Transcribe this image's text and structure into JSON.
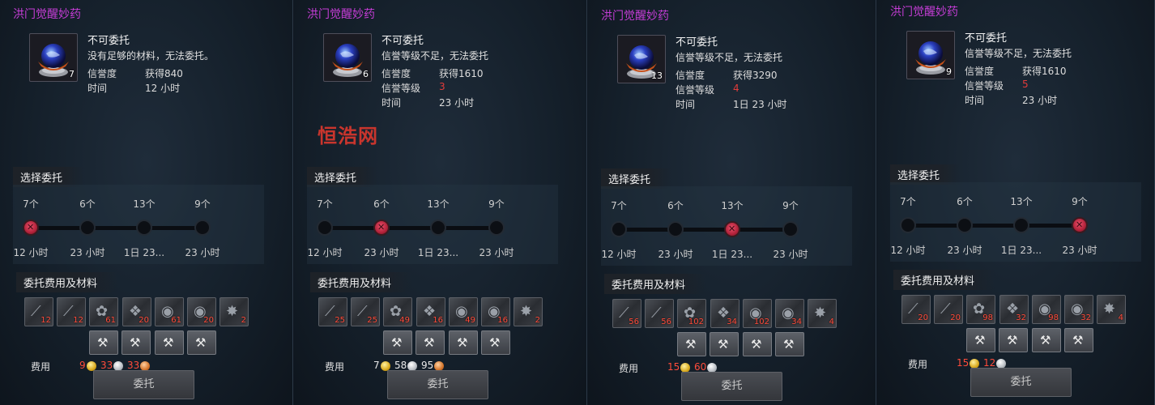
{
  "watermark": "恒浩网",
  "panels": [
    {
      "title": "洪门觉醒妙药",
      "item_count": "7",
      "status": "不可委托",
      "reason": "没有足够的材料，无法委托。",
      "stats": [
        {
          "label": "信誉度",
          "value": "获得840",
          "red": false
        },
        {
          "label": "时间",
          "value": "12 小时",
          "red": false
        }
      ],
      "select_label": "选择委托",
      "options": [
        {
          "count": "7个",
          "time": "12 小时"
        },
        {
          "count": "6个",
          "time": "23 小时"
        },
        {
          "count": "13个",
          "time": "1日 23..."
        },
        {
          "count": "9个",
          "time": "23 小时"
        }
      ],
      "selected_index": 0,
      "materials_label": "委托费用及材料",
      "materials": [
        "12",
        "12",
        "61",
        "20",
        "61",
        "20",
        "2"
      ],
      "fee_label": "费用",
      "fees": [
        {
          "value": "9",
          "coin": "gold"
        },
        {
          "value": "33",
          "coin": "silver"
        },
        {
          "value": "33",
          "coin": "copper"
        }
      ],
      "button": "委托"
    },
    {
      "title": "洪门觉醒妙药",
      "item_count": "6",
      "status": "不可委托",
      "reason": "信誉等级不足，无法委托",
      "stats": [
        {
          "label": "信誉度",
          "value": "获得1610",
          "red": false
        },
        {
          "label": "信誉等级",
          "value": "3",
          "red": true
        },
        {
          "label": "时间",
          "value": "23 小时",
          "red": false
        }
      ],
      "select_label": "选择委托",
      "options": [
        {
          "count": "7个",
          "time": "12 小时"
        },
        {
          "count": "6个",
          "time": "23 小时"
        },
        {
          "count": "13个",
          "time": "1日 23..."
        },
        {
          "count": "9个",
          "time": "23 小时"
        }
      ],
      "selected_index": 1,
      "materials_label": "委托费用及材料",
      "materials": [
        "25",
        "25",
        "49",
        "16",
        "49",
        "16",
        "2"
      ],
      "fee_label": "费用",
      "fees": [
        {
          "value": "7",
          "coin": "gold"
        },
        {
          "value": "58",
          "coin": "silver"
        },
        {
          "value": "95",
          "coin": "copper"
        }
      ],
      "button": "委托"
    },
    {
      "title": "洪门觉醒妙药",
      "item_count": "13",
      "status": "不可委托",
      "reason": "信誉等级不足，无法委托",
      "stats": [
        {
          "label": "信誉度",
          "value": "获得3290",
          "red": false
        },
        {
          "label": "信誉等级",
          "value": "4",
          "red": true
        },
        {
          "label": "时间",
          "value": "1日 23 小时",
          "red": false
        }
      ],
      "select_label": "选择委托",
      "options": [
        {
          "count": "7个",
          "time": "12 小时"
        },
        {
          "count": "6个",
          "time": "23 小时"
        },
        {
          "count": "13个",
          "time": "1日 23..."
        },
        {
          "count": "9个",
          "time": "23 小时"
        }
      ],
      "selected_index": 2,
      "materials_label": "委托费用及材料",
      "materials": [
        "56",
        "56",
        "102",
        "34",
        "102",
        "34",
        "4"
      ],
      "fee_label": "费用",
      "fees": [
        {
          "value": "15",
          "coin": "gold"
        },
        {
          "value": "60",
          "coin": "silver"
        }
      ],
      "button": "委托"
    },
    {
      "title": "洪门觉醒妙药",
      "item_count": "9",
      "status": "不可委托",
      "reason": "信誉等级不足，无法委托",
      "stats": [
        {
          "label": "信誉度",
          "value": "获得1610",
          "red": false
        },
        {
          "label": "信誉等级",
          "value": "5",
          "red": true
        },
        {
          "label": "时间",
          "value": "23 小时",
          "red": false
        }
      ],
      "select_label": "选择委托",
      "options": [
        {
          "count": "7个",
          "time": "12 小时"
        },
        {
          "count": "6个",
          "time": "23 小时"
        },
        {
          "count": "13个",
          "time": "1日 23..."
        },
        {
          "count": "9个",
          "time": "23 小时"
        }
      ],
      "selected_index": 3,
      "materials_label": "委托费用及材料",
      "materials": [
        "20",
        "20",
        "98",
        "32",
        "98",
        "32",
        "4"
      ],
      "fee_label": "费用",
      "fees": [
        {
          "value": "15",
          "coin": "gold"
        },
        {
          "value": "12",
          "coin": "silver"
        }
      ],
      "button": "委托"
    }
  ]
}
